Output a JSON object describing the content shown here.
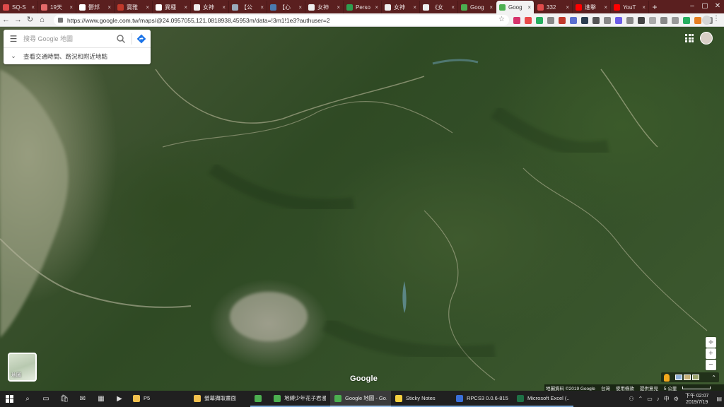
{
  "browser": {
    "tabs": [
      {
        "label": "SQ-S",
        "icon_color": "#e04b4b"
      },
      {
        "label": "19天",
        "icon_color": "#e36a6a"
      },
      {
        "label": "鬱邦",
        "icon_color": "#ffffff"
      },
      {
        "label": "寶雅",
        "icon_color": "#c0392b"
      },
      {
        "label": "異種",
        "icon_color": "#ffffff"
      },
      {
        "label": "女神",
        "icon_color": "#eeeeee"
      },
      {
        "label": "【公",
        "icon_color": "#9ab"
      },
      {
        "label": "【心",
        "icon_color": "#4a7ab0"
      },
      {
        "label": "女神",
        "icon_color": "#eeeeee"
      },
      {
        "label": "Perso",
        "icon_color": "#2e9e4f"
      },
      {
        "label": "女神",
        "icon_color": "#eeeeee"
      },
      {
        "label": "《女",
        "icon_color": "#eeeeee"
      },
      {
        "label": "Goog",
        "icon_color": "#4caf50"
      },
      {
        "label": "Goog",
        "icon_color": "#4caf50",
        "active": true
      },
      {
        "label": "332",
        "icon_color": "#e04b4b"
      },
      {
        "label": "進擊",
        "icon_color": "#ff0000"
      },
      {
        "label": "YouT",
        "icon_color": "#ff0000"
      }
    ],
    "new_tab": "+",
    "url": "https://www.google.com.tw/maps/@24.0957055,121.0818938,45953m/data=!3m1!1e3?authuser=2",
    "extension_colors": [
      "#d6336c",
      "#e84a4a",
      "#27ae60",
      "#888888",
      "#c0392b",
      "#5a6fd0",
      "#2c3e50",
      "#555555",
      "#888888",
      "#6c5ce7",
      "#888888",
      "#444444",
      "#aaaaaa",
      "#888888",
      "#999999",
      "#27ae60",
      "#e67e22",
      "#888888"
    ]
  },
  "maps": {
    "search_placeholder": "搜尋 Google 地圖",
    "explore_label": "查看交通時間、路況和附近地點",
    "layers_label": "地圖",
    "logo": "Google",
    "zoom_in": "+",
    "zoom_out": "−",
    "attribution": {
      "data": "地圖資料 ©2019 Google",
      "region": "台灣",
      "terms": "使用條款",
      "feedback": "提供意見",
      "scale": "5 公里"
    }
  },
  "taskbar": {
    "apps": [
      {
        "label": "P5",
        "icon_color": "#f2c14e",
        "state": ""
      },
      {
        "label": "螢幕擷取畫面",
        "icon_color": "#f2c14e",
        "state": ""
      },
      {
        "label": "",
        "icon_color": "#4caf50",
        "state": "running"
      },
      {
        "label": "地縛少年花子君漫...",
        "icon_color": "#4caf50",
        "state": "running"
      },
      {
        "label": "Google 地圖 - Go...",
        "icon_color": "#4caf50",
        "state": "active"
      },
      {
        "label": "Sticky Notes",
        "icon_color": "#f4d03f",
        "state": "running"
      },
      {
        "label": "RPCS3 0.0.6-8159...",
        "icon_color": "#3a6fd8",
        "state": "running"
      },
      {
        "label": "Microsoft Excel (...",
        "icon_color": "#1e7145",
        "state": "running"
      }
    ],
    "clock_time": "下午 02:07",
    "clock_date": "2019/7/19"
  }
}
